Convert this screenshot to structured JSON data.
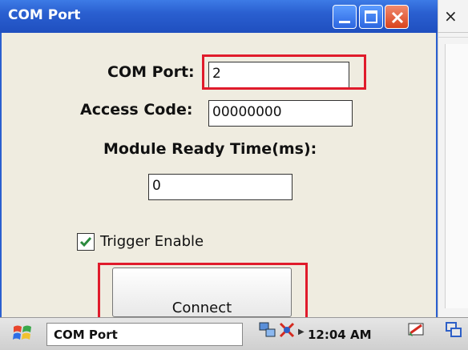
{
  "window": {
    "title": "COM Port"
  },
  "form": {
    "com_port_label": "COM Port:",
    "com_port_value": "2",
    "access_code_label": "Access Code:",
    "access_code_value": "00000000",
    "module_ready_label": "Module Ready Time(ms):",
    "module_ready_value": "0",
    "trigger_enable_label": "Trigger Enable",
    "trigger_enable_checked": true,
    "connect_label": "Connect"
  },
  "side_window": {
    "close_glyph": "×"
  },
  "taskbar": {
    "task_label": "COM Port",
    "clock": "12:04 AM",
    "icons": [
      "start-icon",
      "network-icon",
      "bluetooth-icon",
      "tray-arrow-icon",
      "keyboard-input-icon",
      "window-switch-icon"
    ]
  },
  "colors": {
    "titlebar": "#2a5fd0",
    "highlight": "#e01b2b",
    "close_button": "#d9421d",
    "check": "#2b8a3e"
  }
}
